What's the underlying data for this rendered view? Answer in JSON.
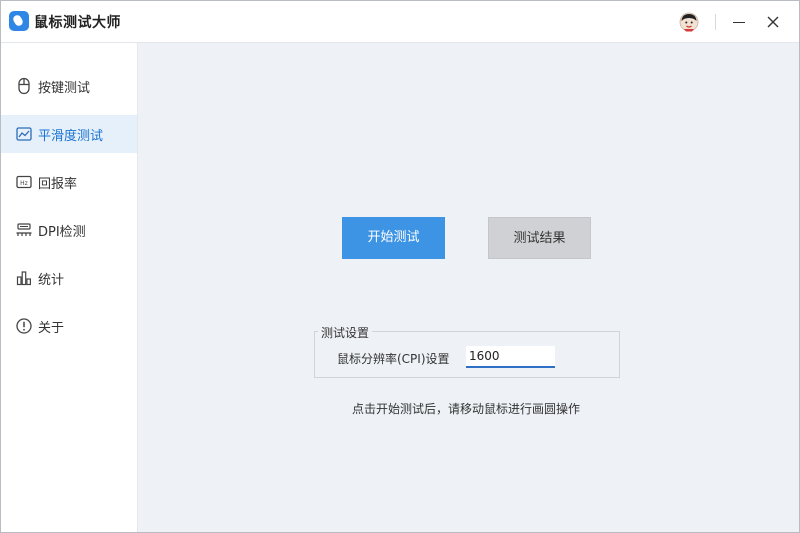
{
  "app": {
    "title": "鼠标测试大师"
  },
  "sidebar": {
    "items": [
      {
        "label": "按键测试",
        "icon": "mouse-icon",
        "active": false
      },
      {
        "label": "平滑度测试",
        "icon": "chart-line-icon",
        "active": true
      },
      {
        "label": "回报率",
        "icon": "hz-icon",
        "active": false
      },
      {
        "label": "DPI检测",
        "icon": "dpi-icon",
        "active": false
      },
      {
        "label": "统计",
        "icon": "bar-chart-icon",
        "active": false
      },
      {
        "label": "关于",
        "icon": "info-icon",
        "active": false
      }
    ]
  },
  "main": {
    "start_button": "开始测试",
    "result_button": "测试结果",
    "settings": {
      "legend": "测试设置",
      "cpi_label": "鼠标分辨率(CPI)设置",
      "cpi_value": "1600"
    },
    "hint": "点击开始测试后，请移动鼠标进行画圆操作"
  },
  "colors": {
    "accent": "#3d93e4",
    "active_bg": "#e6f0fb",
    "main_bg": "#eef2f6"
  }
}
